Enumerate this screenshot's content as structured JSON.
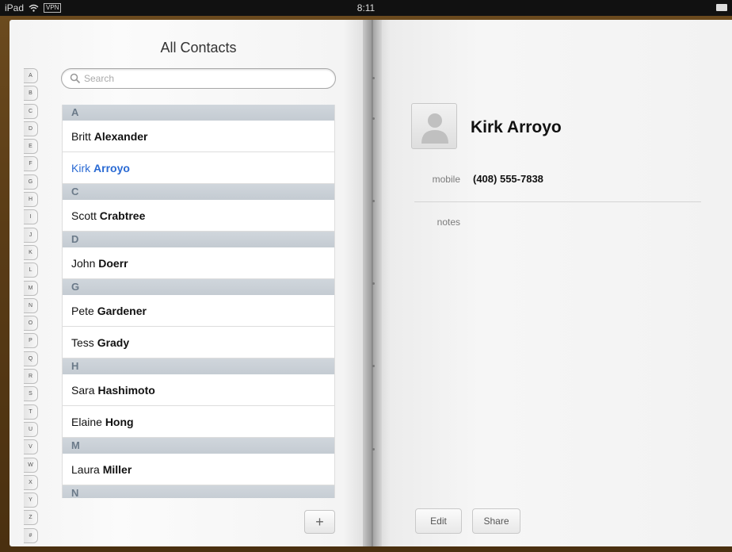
{
  "status_bar": {
    "device": "iPad",
    "vpn": "VPN",
    "time": "8:11"
  },
  "list": {
    "title": "All Contacts",
    "search_placeholder": "Search",
    "index_letters": [
      "A",
      "B",
      "C",
      "D",
      "E",
      "F",
      "G",
      "H",
      "I",
      "J",
      "K",
      "L",
      "M",
      "N",
      "O",
      "P",
      "Q",
      "R",
      "S",
      "T",
      "U",
      "V",
      "W",
      "X",
      "Y",
      "Z",
      "#"
    ],
    "sections": [
      {
        "letter": "A",
        "contacts": [
          {
            "first": "Britt",
            "last": "Alexander"
          },
          {
            "first": "Kirk",
            "last": "Arroyo",
            "selected": true
          }
        ]
      },
      {
        "letter": "C",
        "contacts": [
          {
            "first": "Scott",
            "last": "Crabtree"
          }
        ]
      },
      {
        "letter": "D",
        "contacts": [
          {
            "first": "John",
            "last": "Doerr"
          }
        ]
      },
      {
        "letter": "G",
        "contacts": [
          {
            "first": "Pete",
            "last": "Gardener"
          },
          {
            "first": "Tess",
            "last": "Grady"
          }
        ]
      },
      {
        "letter": "H",
        "contacts": [
          {
            "first": "Sara",
            "last": "Hashimoto"
          },
          {
            "first": "Elaine",
            "last": "Hong"
          }
        ]
      },
      {
        "letter": "M",
        "contacts": [
          {
            "first": "Laura",
            "last": "Miller"
          }
        ]
      },
      {
        "letter": "N",
        "contacts": []
      }
    ],
    "add_label": "+"
  },
  "detail": {
    "name": "Kirk Arroyo",
    "mobile_label": "mobile",
    "mobile_value": "(408) 555-7838",
    "notes_label": "notes",
    "edit_label": "Edit",
    "share_label": "Share"
  },
  "colors": {
    "selected_text": "#2a6ad3",
    "section_text": "#6b7a89",
    "leather": "#5a3c16"
  }
}
